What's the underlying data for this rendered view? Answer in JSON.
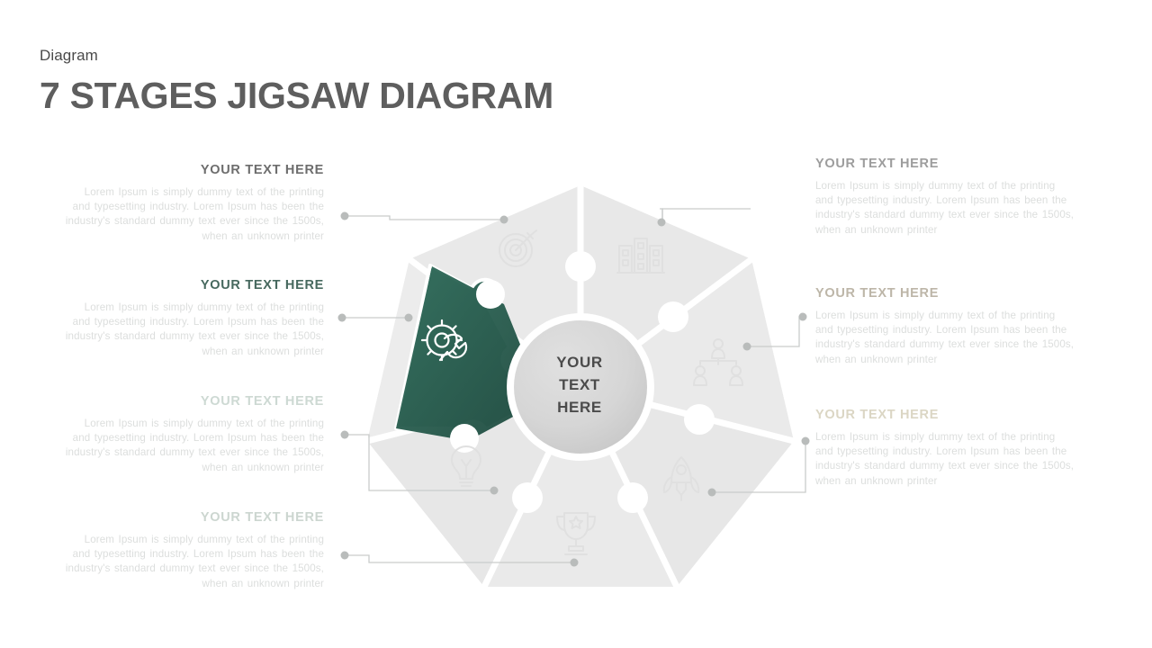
{
  "header": {
    "kicker": "Diagram",
    "title": "7 STAGES JIGSAW DIAGRAM"
  },
  "center": {
    "line1": "YOUR",
    "line2": "TEXT",
    "line3": "HERE"
  },
  "body_text": "Lorem Ipsum is simply dummy text of the printing and typesetting industry. Lorem Ipsum has been the industry's standard dummy text ever since the 1500s, when an unknown printer",
  "colors": {
    "highlight_green": "#2e6255",
    "title_gray": "#5e5e5e",
    "body_gray": "#d9dcdb",
    "puzzle_gray": "#ececec",
    "center_circle": "#d4d4d4",
    "connector": "#c9cccb"
  },
  "blocks": {
    "left": [
      {
        "title": "YOUR TEXT HERE",
        "title_color": "#6d6d6d",
        "body": "Lorem Ipsum is simply dummy text of the printing and typesetting industry. Lorem Ipsum has been the industry's standard dummy text ever since the 1500s, when an unknown printer",
        "body_color": "#dcdedd",
        "icon": "target-icon"
      },
      {
        "title": "YOUR TEXT HERE",
        "title_color": "#46685e",
        "body": "Lorem Ipsum is simply dummy text of the printing and typesetting industry. Lorem Ipsum has been the industry's standard dummy text ever since the 1500s, when an unknown printer",
        "body_color": "#dcdedd",
        "icon": "gear-wrench-icon"
      },
      {
        "title": "YOUR TEXT HERE",
        "title_color": "#cdd9d3",
        "body": "Lorem Ipsum is simply dummy text of the printing and typesetting industry. Lorem Ipsum has been the industry's standard dummy text ever since the 1500s, when an unknown printer",
        "body_color": "#dcdedd",
        "icon": "lightbulb-icon"
      },
      {
        "title": "YOUR TEXT HERE",
        "title_color": "#ccd6d0",
        "body": "Lorem Ipsum is simply dummy text of the printing and typesetting industry. Lorem Ipsum has been the industry's standard dummy text ever since the 1500s, when an unknown printer",
        "body_color": "#dcdedd",
        "icon": "trophy-icon"
      }
    ],
    "right": [
      {
        "title": "YOUR TEXT HERE",
        "title_color": "#9d9d9d",
        "body": "Lorem Ipsum is simply dummy text of the printing and typesetting industry. Lorem Ipsum has been the industry's standard dummy text ever since the 1500s, when an unknown printer",
        "body_color": "#dcdedd",
        "icon": "buildings-icon"
      },
      {
        "title": "YOUR TEXT HERE",
        "title_color": "#bdb6a8",
        "body": "Lorem Ipsum is simply dummy text of the printing and typesetting industry. Lorem Ipsum has been the industry's standard dummy text ever since the 1500s, when an unknown printer",
        "body_color": "#dcdedd",
        "icon": "org-chart-icon"
      },
      {
        "title": "YOUR TEXT HERE",
        "title_color": "#dbd6c4",
        "body": "Lorem Ipsum is simply dummy text of the printing and typesetting industry. Lorem Ipsum has been the industry's standard dummy text ever since the 1500s, when an unknown printer",
        "body_color": "#dcdedd",
        "icon": "rocket-icon"
      }
    ]
  },
  "diagram": {
    "segment_count": 7,
    "highlighted_segment": "gear-wrench-icon"
  }
}
